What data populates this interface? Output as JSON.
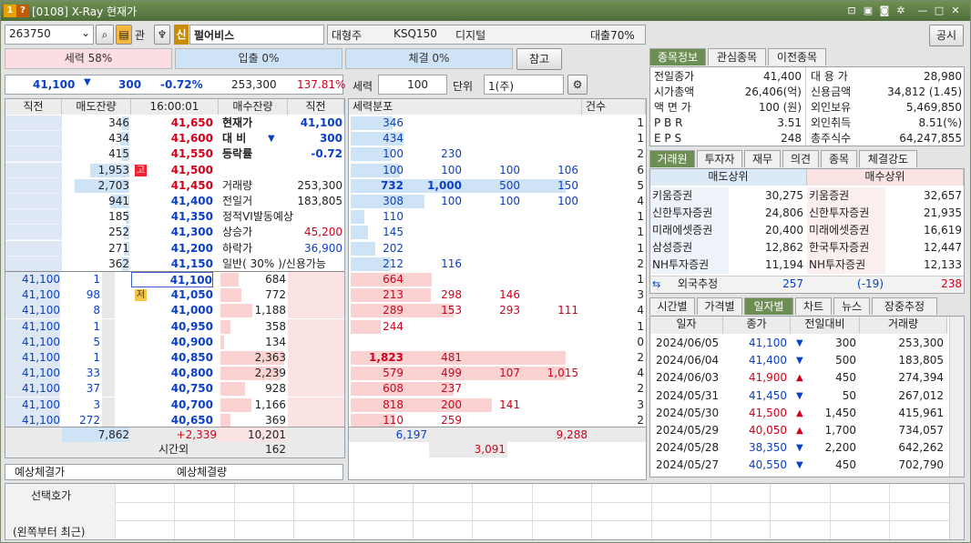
{
  "window": {
    "title": "[0108] X-Ray 현재가"
  },
  "toolbar": {
    "code": "263750",
    "gwan": "관",
    "sin_badge": "신",
    "name": "펄어비스",
    "market_cap_class": "대형주",
    "index_name": "KSQ150",
    "sector": "디지털",
    "loan_ratio": "대출70%",
    "notice_button": "공시"
  },
  "strength_bars": {
    "power": "세력 58%",
    "inout": "입출 0%",
    "exec": "체결 0%",
    "ref_button": "참고"
  },
  "price_line": {
    "price": "41,100",
    "arrow": "▼",
    "change": "300",
    "rate": "-0.72%",
    "volume": "253,300",
    "ratio": "137.81%"
  },
  "power_ctrl": {
    "label": "세력",
    "value": "100",
    "unit_label": "단위",
    "unit_value": "1(주)"
  },
  "ob_header": {
    "prev": "직전",
    "ask_rem": "매도잔량",
    "time": "16:00:01",
    "bid_rem": "매수잔량",
    "prev2": "직전"
  },
  "ask_rows": [
    {
      "ask_qty": "346",
      "price": "41,650",
      "badge": ""
    },
    {
      "ask_qty": "434",
      "price": "41,600",
      "badge": ""
    },
    {
      "ask_qty": "415",
      "price": "41,550",
      "badge": ""
    },
    {
      "ask_qty": "1,953",
      "price": "41,500",
      "badge": "고"
    },
    {
      "ask_qty": "2,703",
      "price": "41,450",
      "badge": ""
    },
    {
      "ask_qty": "941",
      "price": "41,400",
      "badge": ""
    },
    {
      "ask_qty": "185",
      "price": "41,350",
      "badge": ""
    },
    {
      "ask_qty": "252",
      "price": "41,300",
      "badge": ""
    },
    {
      "ask_qty": "271",
      "price": "41,200",
      "badge": ""
    },
    {
      "ask_qty": "362",
      "price": "41,150",
      "badge": ""
    }
  ],
  "info_panel": [
    {
      "label": "현재가",
      "value": "41,100"
    },
    {
      "label": "대 비",
      "value": "300",
      "arrow": "▼"
    },
    {
      "label": "등락률",
      "value": "-0.72"
    },
    {
      "label": "",
      "value": ""
    },
    {
      "label": "거래량",
      "value": "253,300"
    },
    {
      "label": "전일거",
      "value": "183,805"
    },
    {
      "label": "정적VI발동예상",
      "value": ""
    },
    {
      "label": "상승가",
      "value": "45,200"
    },
    {
      "label": "하락가",
      "value": "36,900"
    },
    {
      "label": "일반( 30% )/신용가능",
      "value": ""
    }
  ],
  "bid_rows": [
    {
      "trade_price": "41,100",
      "trade_qty": "1",
      "price": "41,100",
      "bid_qty": "684",
      "badge": ""
    },
    {
      "trade_price": "41,100",
      "trade_qty": "98",
      "price": "41,050",
      "bid_qty": "772",
      "badge": "저"
    },
    {
      "trade_price": "41,100",
      "trade_qty": "8",
      "price": "41,000",
      "bid_qty": "1,188",
      "badge": ""
    },
    {
      "trade_price": "41,100",
      "trade_qty": "1",
      "price": "40,950",
      "bid_qty": "358",
      "badge": ""
    },
    {
      "trade_price": "41,100",
      "trade_qty": "5",
      "price": "40,900",
      "bid_qty": "134",
      "badge": ""
    },
    {
      "trade_price": "41,100",
      "trade_qty": "1",
      "price": "40,850",
      "bid_qty": "2,363",
      "badge": ""
    },
    {
      "trade_price": "41,100",
      "trade_qty": "33",
      "price": "40,800",
      "bid_qty": "2,239",
      "badge": ""
    },
    {
      "trade_price": "41,100",
      "trade_qty": "37",
      "price": "40,750",
      "bid_qty": "928",
      "badge": ""
    },
    {
      "trade_price": "41,100",
      "trade_qty": "3",
      "price": "40,700",
      "bid_qty": "1,166",
      "badge": ""
    },
    {
      "trade_price": "41,100",
      "trade_qty": "272",
      "price": "40,650",
      "bid_qty": "369",
      "badge": ""
    }
  ],
  "ob_footer": {
    "ask_total": "7,862",
    "diff": "+2,339",
    "bid_total": "10,201",
    "after_label": "시간외",
    "after_value": "162"
  },
  "expected": {
    "price_label": "예상체결가",
    "qty_label": "예상체결량"
  },
  "dist_header": {
    "title": "세력분포",
    "count": "건수"
  },
  "dist_rows": [
    {
      "v1": "346",
      "v2": "",
      "v3": "",
      "v4": "",
      "cnt": "1"
    },
    {
      "v1": "434",
      "v2": "",
      "v3": "",
      "v4": "",
      "cnt": "1"
    },
    {
      "v1": "100",
      "v2": "230",
      "v3": "",
      "v4": "",
      "cnt": "2"
    },
    {
      "v1": "100",
      "v2": "100",
      "v3": "100",
      "v4": "106",
      "cnt": "6"
    },
    {
      "v1": "732",
      "v2": "1,000",
      "v3": "500",
      "v4": "150",
      "cnt": "5"
    },
    {
      "v1": "308",
      "v2": "100",
      "v3": "100",
      "v4": "100",
      "cnt": "4"
    },
    {
      "v1": "110",
      "v2": "",
      "v3": "",
      "v4": "",
      "cnt": "1"
    },
    {
      "v1": "145",
      "v2": "",
      "v3": "",
      "v4": "",
      "cnt": "1"
    },
    {
      "v1": "202",
      "v2": "",
      "v3": "",
      "v4": "",
      "cnt": "1"
    },
    {
      "v1": "212",
      "v2": "116",
      "v3": "",
      "v4": "",
      "cnt": "2"
    },
    {
      "v1": "664",
      "v2": "",
      "v3": "",
      "v4": "",
      "cnt": "1"
    },
    {
      "v1": "213",
      "v2": "298",
      "v3": "146",
      "v4": "",
      "cnt": "3"
    },
    {
      "v1": "289",
      "v2": "153",
      "v3": "293",
      "v4": "111",
      "cnt": "4"
    },
    {
      "v1": "244",
      "v2": "",
      "v3": "",
      "v4": "",
      "cnt": "1"
    },
    {
      "v1": "",
      "v2": "",
      "v3": "",
      "v4": "",
      "cnt": "0"
    },
    {
      "v1": "1,823",
      "v2": "481",
      "v3": "",
      "v4": "",
      "cnt": "2"
    },
    {
      "v1": "579",
      "v2": "499",
      "v3": "107",
      "v4": "1,015",
      "cnt": "4"
    },
    {
      "v1": "608",
      "v2": "237",
      "v3": "",
      "v4": "",
      "cnt": "2"
    },
    {
      "v1": "818",
      "v2": "200",
      "v3": "141",
      "v4": "",
      "cnt": "3"
    },
    {
      "v1": "110",
      "v2": "259",
      "v3": "",
      "v4": "",
      "cnt": "2"
    }
  ],
  "dist_footer": {
    "ask_total": "6,197",
    "bid_total": "9,288",
    "net": "3,091"
  },
  "right_tabs1": [
    "종목정보",
    "관심종목",
    "이전종목"
  ],
  "stock_info": [
    {
      "l1": "전일종가",
      "v1": "41,400",
      "l2": "대 용 가",
      "v2": "28,980"
    },
    {
      "l1": "시가총액",
      "v1": "26,406(억)",
      "l2": "신용금액",
      "v2": "34,812  (1.45)"
    },
    {
      "l1": "액 면 가",
      "v1": "100 (원)",
      "l2": "외인보유",
      "v2": "5,469,850"
    },
    {
      "l1": "P B R",
      "v1": "3.51",
      "l2": "외인취득",
      "v2": "8.51(%)"
    },
    {
      "l1": "E P S",
      "v1": "248",
      "l2": "총주식수",
      "v2": "64,247,855"
    }
  ],
  "right_tabs2": [
    "거래원",
    "투자자",
    "재무",
    "의견",
    "종목",
    "체결강도"
  ],
  "broker": {
    "sell_header": "매도상위",
    "buy_header": "매수상위",
    "rows": [
      {
        "sell_name": "키움증권",
        "sell_qty": "30,275",
        "buy_name": "키움증권",
        "buy_qty": "32,657"
      },
      {
        "sell_name": "신한투자증권",
        "sell_qty": "24,806",
        "buy_name": "신한투자증권",
        "buy_qty": "21,935"
      },
      {
        "sell_name": "미래에셋증권",
        "sell_qty": "20,400",
        "buy_name": "미래에셋증권",
        "buy_qty": "16,619"
      },
      {
        "sell_name": "삼성증권",
        "sell_qty": "12,862",
        "buy_name": "한국투자증권",
        "buy_qty": "12,447"
      },
      {
        "sell_name": "NH투자증권",
        "sell_qty": "11,194",
        "buy_name": "NH투자증권",
        "buy_qty": "12,133"
      }
    ],
    "foreign_label": "외국추정",
    "foreign_sell": "257",
    "foreign_net": "(-19)",
    "foreign_buy": "238"
  },
  "right_tabs3": [
    "시간별",
    "가격별",
    "일자별",
    "차트",
    "뉴스",
    "장중추정"
  ],
  "daily_header": {
    "date": "일자",
    "close": "종가",
    "change": "전일대비",
    "volume": "거래량"
  },
  "daily_rows": [
    {
      "date": "2024/06/05",
      "close": "41,100",
      "dir": "▼",
      "change": "300",
      "volume": "253,300",
      "color": "#0b3fc6"
    },
    {
      "date": "2024/06/04",
      "close": "41,400",
      "dir": "▼",
      "change": "500",
      "volume": "183,805",
      "color": "#0b3fc6"
    },
    {
      "date": "2024/06/03",
      "close": "41,900",
      "dir": "▲",
      "change": "450",
      "volume": "274,394",
      "color": "#d0021b"
    },
    {
      "date": "2024/05/31",
      "close": "41,450",
      "dir": "▼",
      "change": "50",
      "volume": "267,012",
      "color": "#0b3fc6"
    },
    {
      "date": "2024/05/30",
      "close": "41,500",
      "dir": "▲",
      "change": "1,450",
      "volume": "415,961",
      "color": "#d0021b"
    },
    {
      "date": "2024/05/29",
      "close": "40,050",
      "dir": "▲",
      "change": "1,700",
      "volume": "734,057",
      "color": "#d0021b"
    },
    {
      "date": "2024/05/28",
      "close": "38,350",
      "dir": "▼",
      "change": "2,200",
      "volume": "642,262",
      "color": "#0b3fc6"
    },
    {
      "date": "2024/05/27",
      "close": "40,550",
      "dir": "▼",
      "change": "450",
      "volume": "702,790",
      "color": "#0b3fc6"
    }
  ],
  "bottom": {
    "label1": "선택호가",
    "label2": "(왼쪽부터 최근)"
  },
  "colors": {
    "title_green": "#5a7a44",
    "ask_blue": "#cfe3f7",
    "bid_pink": "#fbe3e3",
    "up_red": "#d0021b",
    "down_blue": "#0b3fc6"
  }
}
